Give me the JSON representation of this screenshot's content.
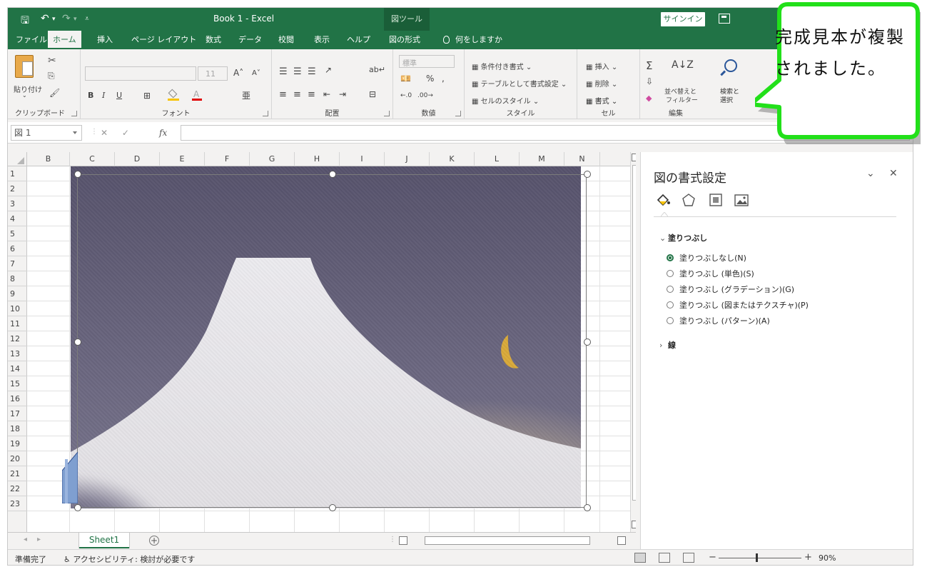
{
  "titlebar": {
    "title": "Book 1  -  Excel",
    "context_tool": "図ツール",
    "signin": "サインイン"
  },
  "tabs": [
    {
      "label": "ファイル"
    },
    {
      "label": "ホーム"
    },
    {
      "label": "挿入"
    },
    {
      "label": "ページ レイアウト"
    },
    {
      "label": "数式"
    },
    {
      "label": "データ"
    },
    {
      "label": "校閲"
    },
    {
      "label": "表示"
    },
    {
      "label": "ヘルプ"
    },
    {
      "label": "図の形式"
    }
  ],
  "tell_me": "何をしますか",
  "ribbon": {
    "clipboard": {
      "paste": "貼り付け",
      "label": "クリップボード"
    },
    "font": {
      "size": "11",
      "label": "フォント",
      "bold": "B",
      "italic": "I",
      "underline": "U"
    },
    "alignment": {
      "label": "配置"
    },
    "number": {
      "format": "標準",
      "label": "数値",
      "percent": "%"
    },
    "styles": {
      "conditional": "条件付き書式",
      "table": "テーブルとして書式設定",
      "cell_style": "セルのスタイル",
      "label": "スタイル"
    },
    "cells": {
      "insert": "挿入",
      "delete": "削除",
      "format": "書式",
      "label": "セル"
    },
    "editing": {
      "sort": "並べ替えと",
      "filter": "フィルター",
      "find": "検索と",
      "select": "選択",
      "label": "編集"
    }
  },
  "formula_bar": {
    "name_box": "図 1",
    "fx": "fx"
  },
  "columns": [
    "B",
    "C",
    "D",
    "E",
    "F",
    "G",
    "H",
    "I",
    "J",
    "K",
    "L",
    "M",
    "N"
  ],
  "rows": [
    "1",
    "2",
    "3",
    "4",
    "5",
    "6",
    "7",
    "8",
    "9",
    "10",
    "11",
    "12",
    "13",
    "14",
    "15",
    "16",
    "17",
    "18",
    "19",
    "20",
    "21",
    "22",
    "23"
  ],
  "sheet": {
    "tab": "Sheet1",
    "add": "+"
  },
  "status": {
    "ready": "準備完了",
    "accessibility": "アクセシビリティ: 検討が必要です",
    "zoom": "90%"
  },
  "pane": {
    "title": "図の書式設定",
    "fill_section": "塗りつぶし",
    "fill_options": [
      {
        "label": "塗りつぶしなし(N)",
        "checked": true
      },
      {
        "label": "塗りつぶし (単色)(S)",
        "checked": false
      },
      {
        "label": "塗りつぶし (グラデーション)(G)",
        "checked": false
      },
      {
        "label": "塗りつぶし (図またはテクスチャ)(P)",
        "checked": false
      },
      {
        "label": "塗りつぶし (パターン)(A)",
        "checked": false
      }
    ],
    "line_section": "線"
  },
  "callout": {
    "text": "完成見本が複製されました。"
  },
  "colors": {
    "excel_green": "#217346",
    "callout_border": "#22e01a",
    "callout_fill": "#ffffff"
  }
}
